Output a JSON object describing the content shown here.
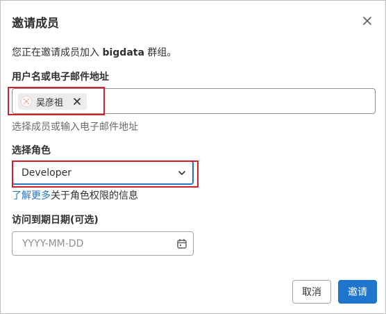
{
  "dialog": {
    "title": "邀请成员",
    "intro_prefix": "您正在邀请成员加入 ",
    "intro_group": "bigdata",
    "intro_suffix": " 群组。"
  },
  "username_field": {
    "label": "用户名或电子邮件地址",
    "token_name": "吴彦祖",
    "help_text": "选择成员或输入电子邮件地址"
  },
  "role_field": {
    "label": "选择角色",
    "selected": "Developer",
    "learn_more_link": "了解更多",
    "learn_more_suffix": "关于角色权限的信息"
  },
  "date_field": {
    "label": "访问到期日期(可选)",
    "placeholder": "YYYY-MM-DD",
    "value": ""
  },
  "footer": {
    "cancel_label": "取消",
    "invite_label": "邀请"
  },
  "colors": {
    "primary": "#1f75cb",
    "highlight": "#d0202a",
    "text": "#303030"
  }
}
